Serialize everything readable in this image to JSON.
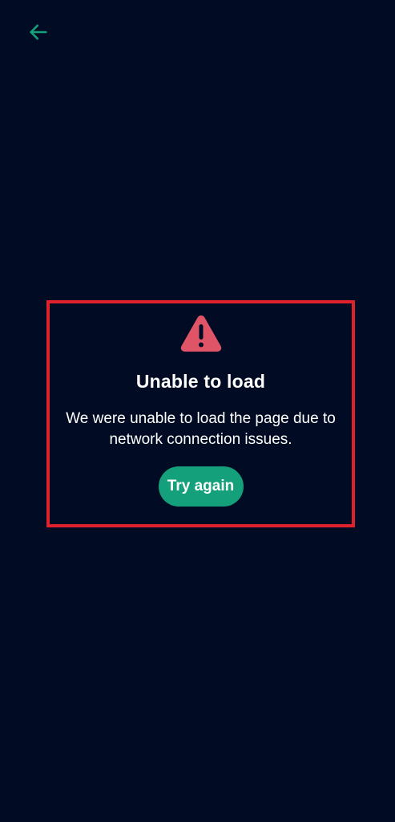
{
  "header": {
    "back_icon": "arrow-left-icon"
  },
  "error": {
    "icon": "warning-triangle-icon",
    "title": "Unable to load",
    "message": "We were unable to load the page due to network connection issues.",
    "retry_label": "Try again"
  },
  "colors": {
    "background": "#010c24",
    "accent": "#14a07a",
    "warning": "#e05468",
    "highlight_border": "#e0222c"
  }
}
